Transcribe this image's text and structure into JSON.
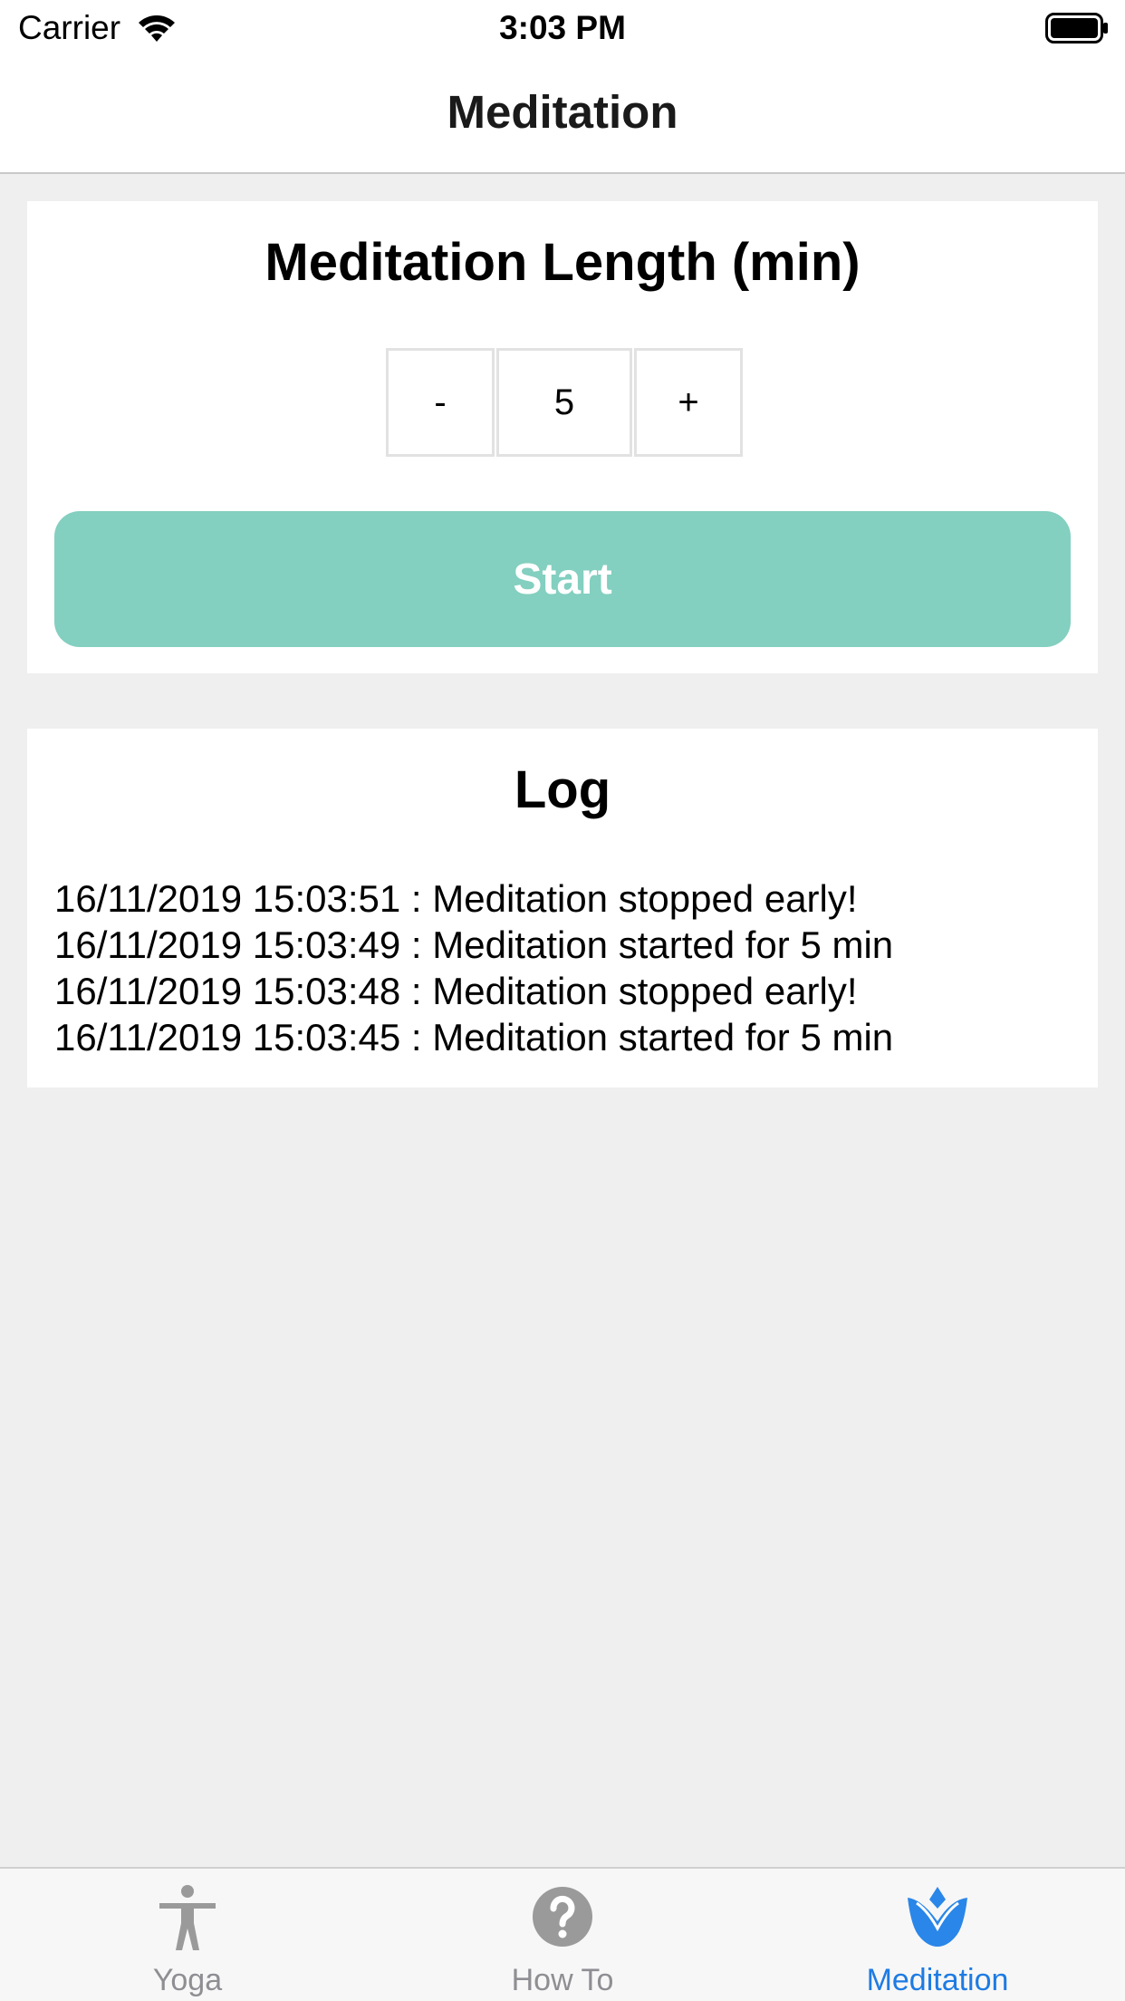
{
  "status_bar": {
    "carrier": "Carrier",
    "time": "3:03 PM",
    "wifi_icon": "wifi-icon",
    "battery_icon": "battery-icon"
  },
  "nav": {
    "title": "Meditation"
  },
  "length_card": {
    "heading": "Meditation Length (min)",
    "minus_label": "-",
    "value": "5",
    "plus_label": "+",
    "start_label": "Start",
    "start_color": "#83cfc0"
  },
  "log_card": {
    "heading": "Log",
    "entries": [
      "16/11/2019 15:03:51 : Meditation stopped early!",
      "16/11/2019 15:03:49 : Meditation started for 5 min",
      "16/11/2019 15:03:48 : Meditation stopped early!",
      "16/11/2019 15:03:45 : Meditation started for 5 min"
    ]
  },
  "tab_bar": {
    "tabs": [
      {
        "label": "Yoga",
        "icon": "person-icon",
        "selected": false
      },
      {
        "label": "How To",
        "icon": "question-icon",
        "selected": false
      },
      {
        "label": "Meditation",
        "icon": "lotus-icon",
        "selected": true
      }
    ],
    "active_color": "#1e7be3",
    "inactive_color": "#8e8e93"
  }
}
